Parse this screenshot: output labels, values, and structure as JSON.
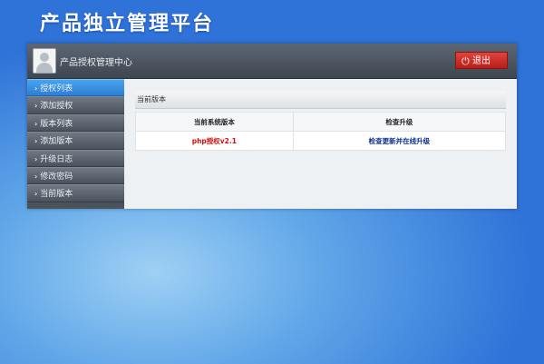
{
  "brand": {
    "title": "产品独立管理平台"
  },
  "header": {
    "title": "产品授权管理中心",
    "logout_label": "退出"
  },
  "sidebar": {
    "items": [
      {
        "label": "授权列表",
        "active": true
      },
      {
        "label": "添加授权"
      },
      {
        "label": "版本列表"
      },
      {
        "label": "添加版本"
      },
      {
        "label": "升级日志"
      },
      {
        "label": "修改密码"
      },
      {
        "label": "当前版本"
      }
    ]
  },
  "main": {
    "section_title": "当前版本",
    "table": {
      "headers": [
        "当前系统版本",
        "检查升级"
      ],
      "rows": [
        {
          "version": "php授权v2.1",
          "action": "检查更新并在线升级"
        }
      ]
    }
  },
  "colors": {
    "accent": "#2b7fd6",
    "logout_red": "#c9281f",
    "version_red": "#cc1010",
    "link_blue": "#0b2e8f"
  }
}
